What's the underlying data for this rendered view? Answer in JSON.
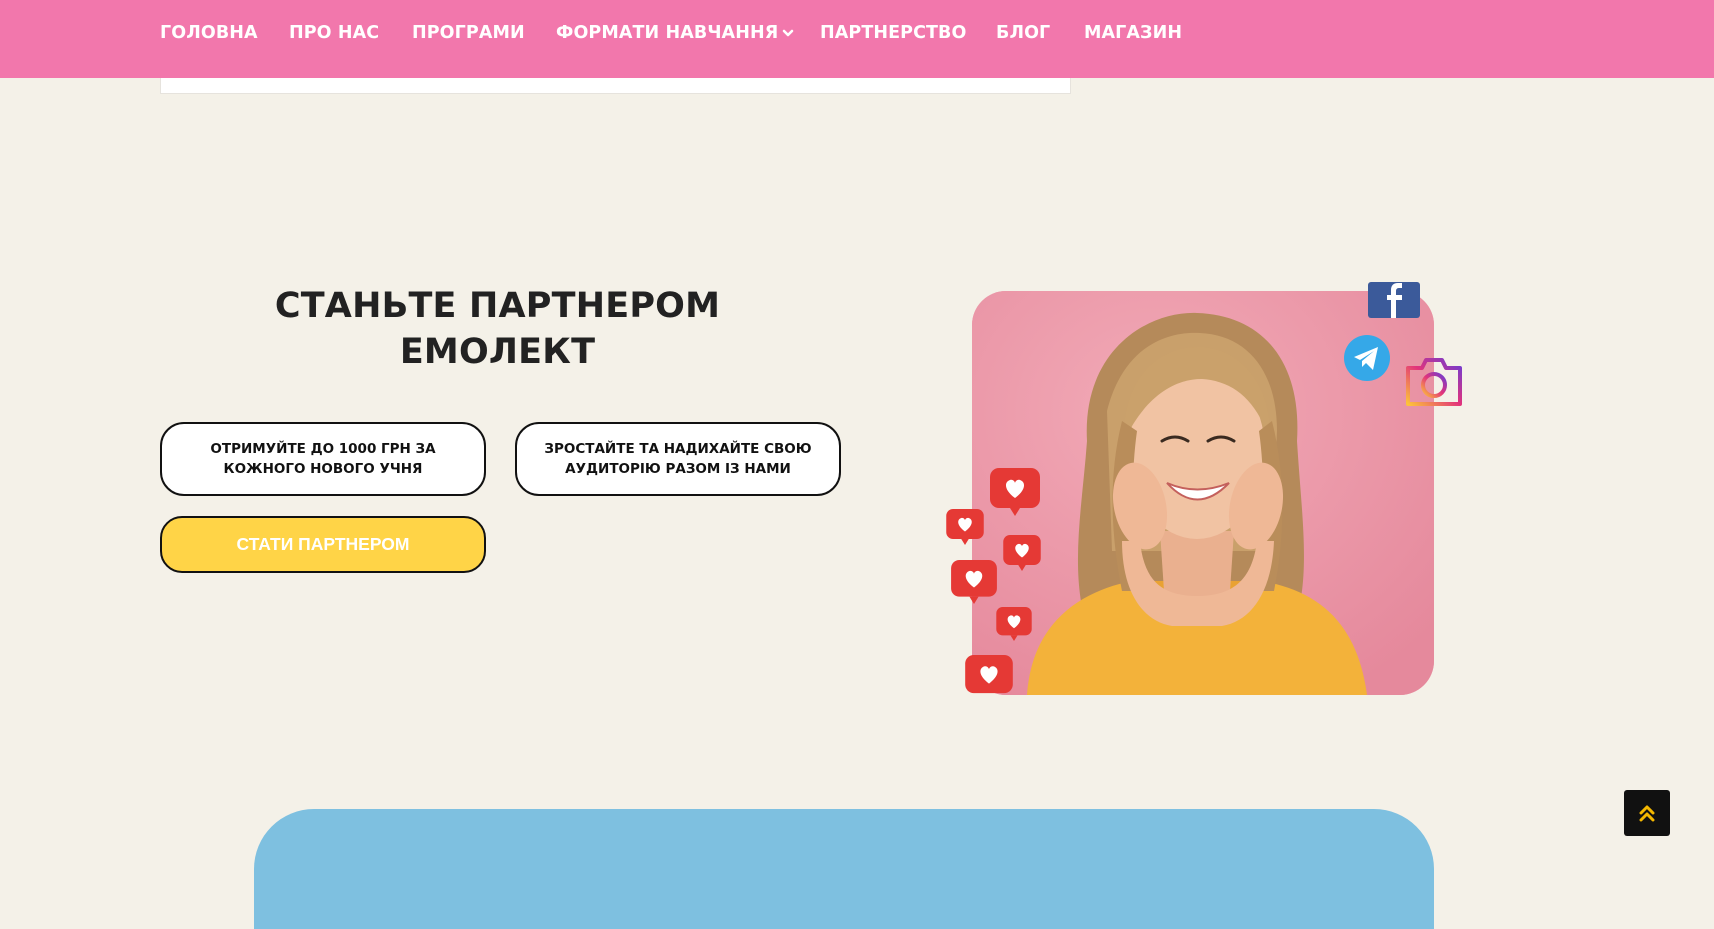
{
  "nav": {
    "items": [
      {
        "label": "ГОЛОВНА"
      },
      {
        "label": "ПРО НАС"
      },
      {
        "label": "ПРОГРАМИ"
      },
      {
        "label": "ФОРМАТИ НАВЧАННЯ"
      },
      {
        "label": "ПАРТНЕРСТВО"
      },
      {
        "label": "БЛОГ"
      },
      {
        "label": "МАГАЗИН"
      }
    ],
    "background": "#f277ac"
  },
  "hero": {
    "title_line1": "СТАНЬТЕ ПАРТНЕРОМ",
    "title_line2": "ЕМОЛЕКТ",
    "benefit_1": "ОТРИМУЙТЕ ДО 1000 ГРН ЗА КОЖНОГО НОВОГО УЧНЯ",
    "benefit_2": "ЗРОСТАЙТЕ ТА НАДИХАЙТЕ СВОЮ АУДИТОРІЮ РАЗОМ ІЗ НАМИ",
    "cta_label": "СТАТИ ПАРТНЕРОМ"
  },
  "icons": {
    "social": [
      "facebook-icon",
      "telegram-icon",
      "instagram-icon"
    ],
    "decor": "heart-icon",
    "scroll": "double-chevron-up-icon"
  },
  "colors": {
    "page_bg": "#f4f1e8",
    "accent_pink": "#f277ac",
    "cta_yellow": "#ffd447",
    "panel_blue": "#7ec0e0",
    "heart_red": "#e53935"
  }
}
